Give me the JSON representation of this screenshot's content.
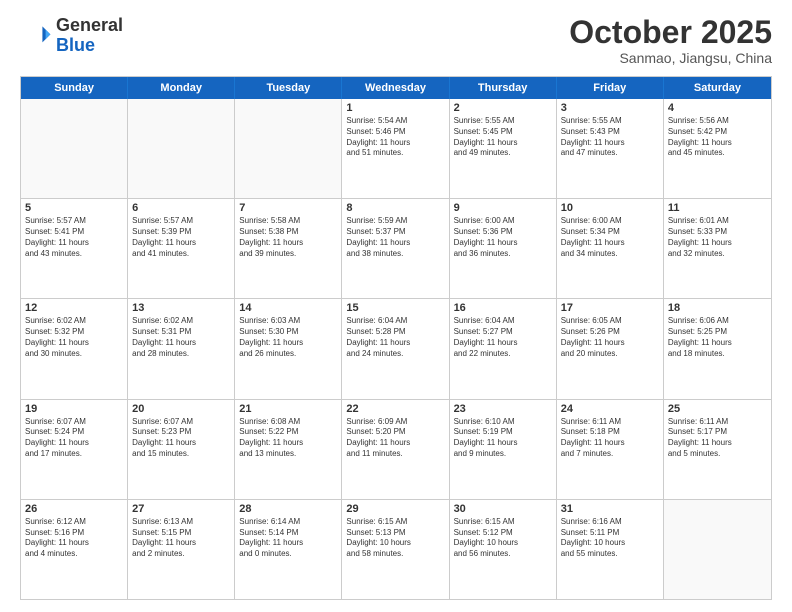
{
  "header": {
    "logo_general": "General",
    "logo_blue": "Blue",
    "month": "October 2025",
    "location": "Sanmao, Jiangsu, China"
  },
  "days_of_week": [
    "Sunday",
    "Monday",
    "Tuesday",
    "Wednesday",
    "Thursday",
    "Friday",
    "Saturday"
  ],
  "weeks": [
    [
      {
        "day": "",
        "empty": true
      },
      {
        "day": "",
        "empty": true
      },
      {
        "day": "",
        "empty": true
      },
      {
        "day": "1",
        "lines": [
          "Sunrise: 5:54 AM",
          "Sunset: 5:46 PM",
          "Daylight: 11 hours",
          "and 51 minutes."
        ]
      },
      {
        "day": "2",
        "lines": [
          "Sunrise: 5:55 AM",
          "Sunset: 5:45 PM",
          "Daylight: 11 hours",
          "and 49 minutes."
        ]
      },
      {
        "day": "3",
        "lines": [
          "Sunrise: 5:55 AM",
          "Sunset: 5:43 PM",
          "Daylight: 11 hours",
          "and 47 minutes."
        ]
      },
      {
        "day": "4",
        "lines": [
          "Sunrise: 5:56 AM",
          "Sunset: 5:42 PM",
          "Daylight: 11 hours",
          "and 45 minutes."
        ]
      }
    ],
    [
      {
        "day": "5",
        "lines": [
          "Sunrise: 5:57 AM",
          "Sunset: 5:41 PM",
          "Daylight: 11 hours",
          "and 43 minutes."
        ]
      },
      {
        "day": "6",
        "lines": [
          "Sunrise: 5:57 AM",
          "Sunset: 5:39 PM",
          "Daylight: 11 hours",
          "and 41 minutes."
        ]
      },
      {
        "day": "7",
        "lines": [
          "Sunrise: 5:58 AM",
          "Sunset: 5:38 PM",
          "Daylight: 11 hours",
          "and 39 minutes."
        ]
      },
      {
        "day": "8",
        "lines": [
          "Sunrise: 5:59 AM",
          "Sunset: 5:37 PM",
          "Daylight: 11 hours",
          "and 38 minutes."
        ]
      },
      {
        "day": "9",
        "lines": [
          "Sunrise: 6:00 AM",
          "Sunset: 5:36 PM",
          "Daylight: 11 hours",
          "and 36 minutes."
        ]
      },
      {
        "day": "10",
        "lines": [
          "Sunrise: 6:00 AM",
          "Sunset: 5:34 PM",
          "Daylight: 11 hours",
          "and 34 minutes."
        ]
      },
      {
        "day": "11",
        "lines": [
          "Sunrise: 6:01 AM",
          "Sunset: 5:33 PM",
          "Daylight: 11 hours",
          "and 32 minutes."
        ]
      }
    ],
    [
      {
        "day": "12",
        "lines": [
          "Sunrise: 6:02 AM",
          "Sunset: 5:32 PM",
          "Daylight: 11 hours",
          "and 30 minutes."
        ]
      },
      {
        "day": "13",
        "lines": [
          "Sunrise: 6:02 AM",
          "Sunset: 5:31 PM",
          "Daylight: 11 hours",
          "and 28 minutes."
        ]
      },
      {
        "day": "14",
        "lines": [
          "Sunrise: 6:03 AM",
          "Sunset: 5:30 PM",
          "Daylight: 11 hours",
          "and 26 minutes."
        ]
      },
      {
        "day": "15",
        "lines": [
          "Sunrise: 6:04 AM",
          "Sunset: 5:28 PM",
          "Daylight: 11 hours",
          "and 24 minutes."
        ]
      },
      {
        "day": "16",
        "lines": [
          "Sunrise: 6:04 AM",
          "Sunset: 5:27 PM",
          "Daylight: 11 hours",
          "and 22 minutes."
        ]
      },
      {
        "day": "17",
        "lines": [
          "Sunrise: 6:05 AM",
          "Sunset: 5:26 PM",
          "Daylight: 11 hours",
          "and 20 minutes."
        ]
      },
      {
        "day": "18",
        "lines": [
          "Sunrise: 6:06 AM",
          "Sunset: 5:25 PM",
          "Daylight: 11 hours",
          "and 18 minutes."
        ]
      }
    ],
    [
      {
        "day": "19",
        "lines": [
          "Sunrise: 6:07 AM",
          "Sunset: 5:24 PM",
          "Daylight: 11 hours",
          "and 17 minutes."
        ]
      },
      {
        "day": "20",
        "lines": [
          "Sunrise: 6:07 AM",
          "Sunset: 5:23 PM",
          "Daylight: 11 hours",
          "and 15 minutes."
        ]
      },
      {
        "day": "21",
        "lines": [
          "Sunrise: 6:08 AM",
          "Sunset: 5:22 PM",
          "Daylight: 11 hours",
          "and 13 minutes."
        ]
      },
      {
        "day": "22",
        "lines": [
          "Sunrise: 6:09 AM",
          "Sunset: 5:20 PM",
          "Daylight: 11 hours",
          "and 11 minutes."
        ]
      },
      {
        "day": "23",
        "lines": [
          "Sunrise: 6:10 AM",
          "Sunset: 5:19 PM",
          "Daylight: 11 hours",
          "and 9 minutes."
        ]
      },
      {
        "day": "24",
        "lines": [
          "Sunrise: 6:11 AM",
          "Sunset: 5:18 PM",
          "Daylight: 11 hours",
          "and 7 minutes."
        ]
      },
      {
        "day": "25",
        "lines": [
          "Sunrise: 6:11 AM",
          "Sunset: 5:17 PM",
          "Daylight: 11 hours",
          "and 5 minutes."
        ]
      }
    ],
    [
      {
        "day": "26",
        "lines": [
          "Sunrise: 6:12 AM",
          "Sunset: 5:16 PM",
          "Daylight: 11 hours",
          "and 4 minutes."
        ]
      },
      {
        "day": "27",
        "lines": [
          "Sunrise: 6:13 AM",
          "Sunset: 5:15 PM",
          "Daylight: 11 hours",
          "and 2 minutes."
        ]
      },
      {
        "day": "28",
        "lines": [
          "Sunrise: 6:14 AM",
          "Sunset: 5:14 PM",
          "Daylight: 11 hours",
          "and 0 minutes."
        ]
      },
      {
        "day": "29",
        "lines": [
          "Sunrise: 6:15 AM",
          "Sunset: 5:13 PM",
          "Daylight: 10 hours",
          "and 58 minutes."
        ]
      },
      {
        "day": "30",
        "lines": [
          "Sunrise: 6:15 AM",
          "Sunset: 5:12 PM",
          "Daylight: 10 hours",
          "and 56 minutes."
        ]
      },
      {
        "day": "31",
        "lines": [
          "Sunrise: 6:16 AM",
          "Sunset: 5:11 PM",
          "Daylight: 10 hours",
          "and 55 minutes."
        ]
      },
      {
        "day": "",
        "empty": true
      }
    ]
  ]
}
